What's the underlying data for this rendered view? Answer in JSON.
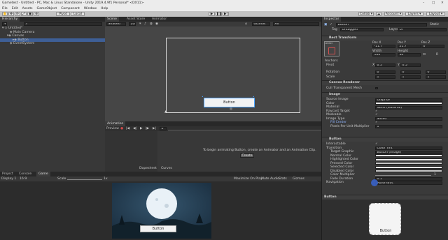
{
  "window": {
    "title": "Gametest - Untitled - PC, Mac & Linux Standalone - Unity 2019.4.9f1 Personal* <DX11>"
  },
  "menu": [
    "File",
    "Edit",
    "Assets",
    "GameObject",
    "Component",
    "Window",
    "Help"
  ],
  "toolbar": {
    "pivot": "Pivot",
    "local": "Local",
    "collab": "Collab ▾",
    "account": "Account ▾",
    "layers": "Layers ▾",
    "layout": "Layout ▾"
  },
  "hierarchy": {
    "tab": "Hierarchy",
    "items": [
      {
        "label": "Untitled*",
        "indent": 0
      },
      {
        "label": "Main Camera",
        "indent": 2
      },
      {
        "label": "Canvas",
        "indent": 2
      },
      {
        "label": "Button",
        "indent": 3
      },
      {
        "label": "EventSystem",
        "indent": 2
      }
    ]
  },
  "scene": {
    "tabs": [
      "Scene",
      "Asset Store",
      "Animator"
    ],
    "shading": "Shaded",
    "mode": "2D",
    "gizmos": "Gizmos",
    "search": "All",
    "button_label": "Button"
  },
  "animation": {
    "tab": "Animation",
    "preview": "Preview",
    "samples": "0",
    "message": "To begin animating Button, create an Animator and an Animation Clip.",
    "create": "Create",
    "dopesheet": "Dopesheet",
    "curves": "Curves"
  },
  "game": {
    "tabs": [
      "Project",
      "Console",
      "Game"
    ],
    "display": "Display 1",
    "aspect": "16:9",
    "scale_label": "Scale",
    "scale": "1x",
    "options": [
      "Maximize On Play",
      "Mute Audio",
      "Stats",
      "Gizmos"
    ],
    "button_label": "Button",
    "colors": {
      "sky": "#1d3244",
      "moon": "#e9f1f7",
      "grass": "#11212b"
    }
  },
  "inspector": {
    "tab": "Inspector",
    "name": "Button",
    "static": "Static",
    "tag_label": "Tag",
    "tag": "Untagged",
    "layer_label": "Layer",
    "layer": "UI",
    "rect_transform": {
      "title": "Rect Transform",
      "anchor": "center",
      "posx_label": "Pos X",
      "posy_label": "Pos Y",
      "posz_label": "Pos Z",
      "posx": "-11.7",
      "posy": "21.7",
      "posz": "0",
      "width_label": "Width",
      "height_label": "Height",
      "width": "160",
      "height": "30",
      "anchors": "Anchors",
      "pivot_label": "Pivot",
      "pivot_x": "0.5",
      "pivot_y": "0.5",
      "rotation": "Rotation",
      "scale": "Scale",
      "rot": [
        "0",
        "0",
        "0"
      ],
      "scl": [
        "1",
        "1",
        "1"
      ],
      "x": "X",
      "y": "Y",
      "z": "Z"
    },
    "canvas_renderer": {
      "title": "Canvas Renderer",
      "cull": "Cull Transparent Mesh"
    },
    "image": {
      "title": "Image",
      "rows": [
        {
          "label": "Source Image",
          "value": "UISprite"
        },
        {
          "label": "Color",
          "value": ""
        },
        {
          "label": "Material",
          "value": "None (Material)"
        },
        {
          "label": "Raycast Target",
          "value": "✓"
        },
        {
          "label": "Maskable",
          "value": "✓"
        },
        {
          "label": "Image Type",
          "value": "Sliced"
        },
        {
          "label": "Fill Center",
          "value": "✓"
        },
        {
          "label": "Pixels Per Unit Multiplier",
          "value": "1"
        }
      ]
    },
    "button": {
      "title": "Button",
      "rows": [
        {
          "label": "Interactable",
          "value": "✓"
        },
        {
          "label": "Transition",
          "value": "Color Tint"
        },
        {
          "label": "Target Graphic",
          "value": "Button (Image)"
        },
        {
          "label": "Normal Color",
          "value": ""
        },
        {
          "label": "Highlighted Color",
          "value": ""
        },
        {
          "label": "Pressed Color",
          "value": ""
        },
        {
          "label": "Selected Color",
          "value": ""
        },
        {
          "label": "Disabled Color",
          "value": ""
        },
        {
          "label": "Color Multiplier",
          "value": "1"
        },
        {
          "label": "Fade Duration",
          "value": "0.1"
        },
        {
          "label": "Navigation",
          "value": "Automatic"
        }
      ]
    },
    "preview_title": "Button",
    "preview_label": "Button"
  }
}
